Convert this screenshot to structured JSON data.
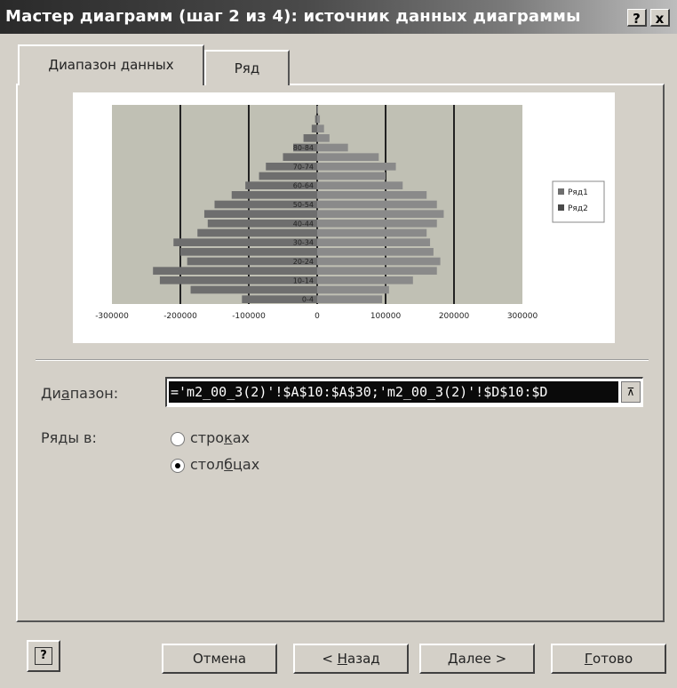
{
  "window": {
    "title": "Мастер диаграмм (шаг 2 из 4): источник данных диаграммы",
    "help_label": "?",
    "close_label": "x"
  },
  "tabs": [
    {
      "label": "Диапазон данных",
      "active": true
    },
    {
      "label": "Ряд",
      "active": false
    }
  ],
  "chart_data": {
    "type": "bar",
    "orientation": "horizontal",
    "stacked": true,
    "categories": [
      "0-4",
      "5-9",
      "10-14",
      "15-19",
      "20-24",
      "25-29",
      "30-34",
      "35-39",
      "40-44",
      "45-49",
      "50-54",
      "55-59",
      "60-64",
      "65-69",
      "70-74",
      "75-79",
      "80-84",
      "85-89",
      "90-94",
      "95-99",
      "100+"
    ],
    "category_labels_shown": [
      "0-4",
      "10-14",
      "20-24",
      "30-34",
      "40-44",
      "50-54",
      "60-64",
      "70-74",
      "80-84"
    ],
    "series": [
      {
        "name": "Ряд1",
        "values": [
          -110000,
          -185000,
          -230000,
          -240000,
          -190000,
          -200000,
          -210000,
          -175000,
          -160000,
          -165000,
          -150000,
          -125000,
          -105000,
          -85000,
          -75000,
          -50000,
          -35000,
          -20000,
          -8000,
          -3000,
          -1000
        ]
      },
      {
        "name": "Ряд2",
        "values": [
          95000,
          105000,
          140000,
          175000,
          180000,
          170000,
          165000,
          160000,
          175000,
          185000,
          175000,
          160000,
          125000,
          100000,
          115000,
          90000,
          45000,
          18000,
          10000,
          4000,
          1000
        ]
      }
    ],
    "xticks": [
      -300000,
      -200000,
      -100000,
      0,
      100000,
      200000,
      300000
    ],
    "xtick_labels": [
      "-300000",
      "-200000",
      "-100000",
      "0",
      "100000",
      "200000",
      "300000"
    ],
    "xlim": [
      -300000,
      300000
    ],
    "grid": "vertical",
    "legend": "right",
    "colors": {
      "plot_bg": "#c0c0b4",
      "bar": "#7a7a7a",
      "grid": "#222222"
    }
  },
  "form": {
    "range_label": "Диапазон:",
    "range_value": "='m2_00_3(2)'!$A$10:$A$30;'m2_00_3(2)'!$D$10:$D",
    "series_in_label": "Ряды в:",
    "radio_rows_label": "строках",
    "radio_cols_label": "столбцах",
    "selected": "cols"
  },
  "buttons": {
    "help_icon": "help-icon",
    "cancel": "Отмена",
    "back": "< Назад",
    "next": "Далее >",
    "finish": "Готово"
  }
}
